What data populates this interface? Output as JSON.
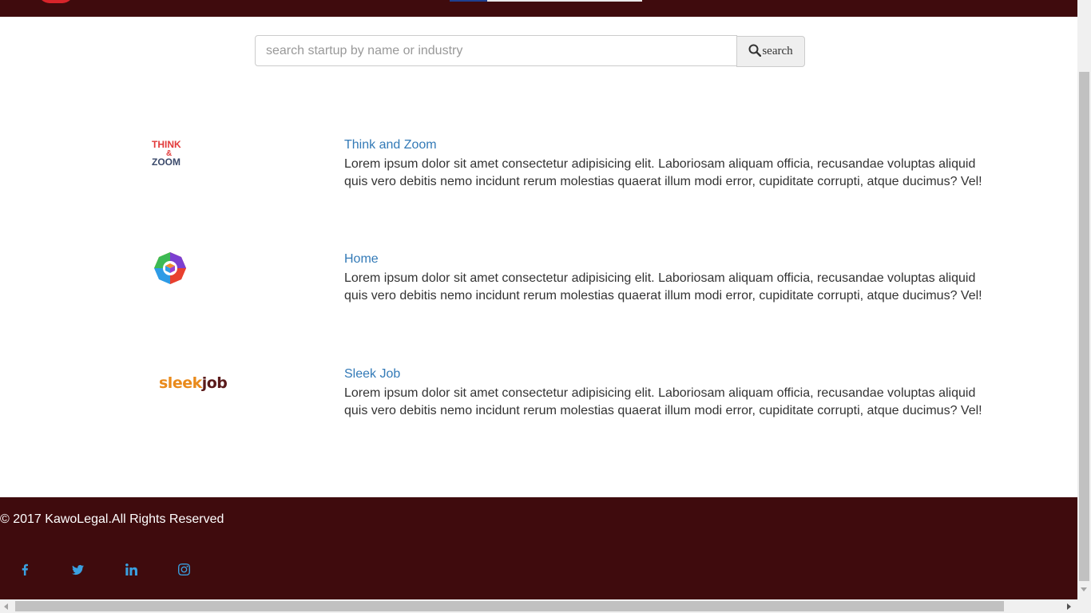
{
  "search": {
    "placeholder": "search startup by name or industry",
    "button_label": "search"
  },
  "startups": [
    {
      "name": "Think and Zoom",
      "logo": "think-and-zoom-logo",
      "description_line1": "Lorem ipsum dolor sit amet consectetur adipisicing elit. Laboriosam aliquam officia, recusandae voluptas aliquid",
      "description_line2": "quis vero debitis nemo incidunt rerum molestias quaerat illum modi error, cupiditate corrupti, atque ducimus? Vel!"
    },
    {
      "name": "Home",
      "logo": "hexagon-cube-logo",
      "description_line1": "Lorem ipsum dolor sit amet consectetur adipisicing elit. Laboriosam aliquam officia, recusandae voluptas aliquid",
      "description_line2": "quis vero debitis nemo incidunt rerum molestias quaerat illum modi error, cupiditate corrupti, atque ducimus? Vel!"
    },
    {
      "name": "Sleek Job",
      "logo": "sleekjob-logo",
      "description_line1": "Lorem ipsum dolor sit amet consectetur adipisicing elit. Laboriosam aliquam officia, recusandae voluptas aliquid",
      "description_line2": "quis vero debitis nemo incidunt rerum molestias quaerat illum modi error, cupiditate corrupti, atque ducimus? Vel!"
    }
  ],
  "logos": {
    "think_top": "THINK",
    "think_mid": "&",
    "think_bottom": "ZOOM",
    "sleek_part1": "sleek",
    "sleek_part2": "job"
  },
  "footer": {
    "copyright": "© 2017 KawoLegal.All Rights Reserved",
    "social": [
      "facebook-icon",
      "twitter-icon",
      "linkedin-icon",
      "instagram-icon"
    ]
  },
  "colors": {
    "brand_dark": "#3f0b0d",
    "link": "#337ab7",
    "social": "#3aa0e0"
  }
}
